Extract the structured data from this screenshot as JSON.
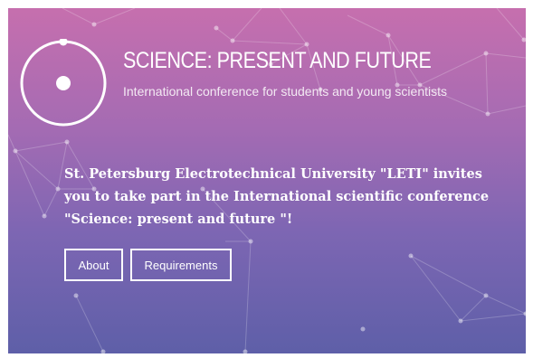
{
  "header": {
    "title": "SCIENCE: PRESENT AND FUTURE",
    "subtitle": "International conference for students and young scientists"
  },
  "intro": {
    "text": "St. Petersburg Electrotechnical University \"LETI\" invites you to take part in the International scientific conference \"Science: present and future \"!"
  },
  "buttons": {
    "about": "About",
    "requirements": "Requirements"
  },
  "colors": {
    "gradient_top": "#c66fae",
    "gradient_bottom": "#5e5fa8",
    "text": "#ffffff"
  },
  "icons": {
    "logo": "orbit-logo-icon"
  }
}
